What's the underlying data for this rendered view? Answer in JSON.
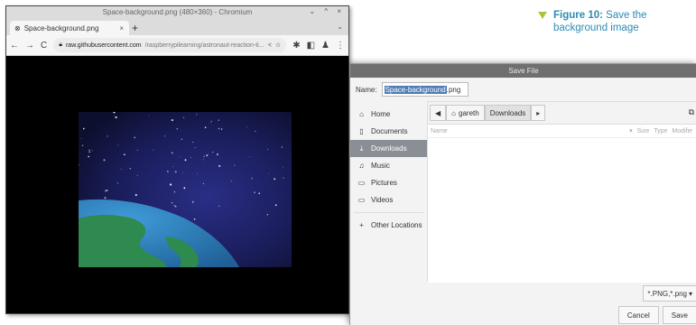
{
  "browser": {
    "window_title": "Space-background.png (480×360) - Chromium",
    "window_controls": "⌄ ^ ×",
    "tab_title": "Space-background.png",
    "tab_close": "×",
    "new_tab": "+",
    "tab_dropdown": "⌄",
    "url_domain": "raw.githubusercontent.com",
    "url_path": "/raspberrypilearning/astronaut-reaction-ti..."
  },
  "dialog": {
    "title": "Save File",
    "name_label": "Name:",
    "filename_selected": "Space-background",
    "filename_ext": ".png",
    "places": [
      {
        "label": "Home",
        "icon": "home-icon",
        "glyph": "⌂"
      },
      {
        "label": "Documents",
        "icon": "document-icon",
        "glyph": "▯"
      },
      {
        "label": "Downloads",
        "icon": "download-icon",
        "glyph": "⤓"
      },
      {
        "label": "Music",
        "icon": "music-icon",
        "glyph": "♫"
      },
      {
        "label": "Pictures",
        "icon": "picture-icon",
        "glyph": "▭"
      },
      {
        "label": "Videos",
        "icon": "video-icon",
        "glyph": "▭"
      }
    ],
    "other_locations": "Other Locations",
    "path": [
      "gareth",
      "Downloads"
    ],
    "columns": {
      "name": "Name",
      "size": "Size",
      "type": "Type",
      "modified": "Modifie"
    },
    "filter": "*.PNG,*.png",
    "cancel": "Cancel",
    "save": "Save"
  },
  "caption": {
    "label": "Figure 10:",
    "line1": "Save the",
    "line2": "background image"
  },
  "colors": {
    "accent": "#2d8ab3",
    "bullet": "#a7c73a",
    "selection": "#4f7bb4",
    "active_place": "#8a8f96"
  }
}
